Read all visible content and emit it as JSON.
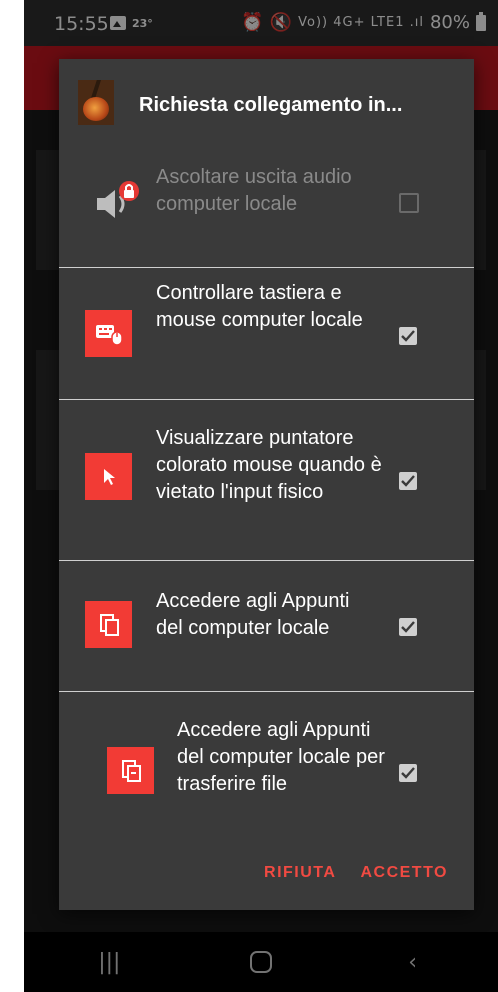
{
  "status_bar": {
    "time": "15:55",
    "temperature": "23°",
    "network_icons": "Vo)) 4G+ LTE1 .ıl",
    "battery": "80%"
  },
  "dialog": {
    "title": "Richiesta collegamento in...",
    "permissions": [
      {
        "label": "Ascoltare uscita audio computer locale",
        "icon": "speaker-locked-icon",
        "enabled": false,
        "checked": false
      },
      {
        "label": "Controllare tastiera e mouse computer locale",
        "icon": "keyboard-mouse-icon",
        "enabled": true,
        "checked": true
      },
      {
        "label": "Visualizzare puntatore colorato mouse quando è vietato l'input fisico",
        "icon": "pointer-icon",
        "enabled": true,
        "checked": true
      },
      {
        "label": "Accedere agli Appunti del computer locale",
        "icon": "clipboard-icon",
        "enabled": true,
        "checked": true
      },
      {
        "label": "Accedere agli Appunti del computer locale per trasferire file",
        "icon": "clipboard-file-icon",
        "enabled": true,
        "checked": true
      }
    ],
    "actions": {
      "reject": "RIFIUTA",
      "accept": "ACCETTO"
    }
  },
  "colors": {
    "accent": "#f23b35",
    "dialog_bg": "#3a3a3a",
    "appbar": "#c2171f"
  }
}
